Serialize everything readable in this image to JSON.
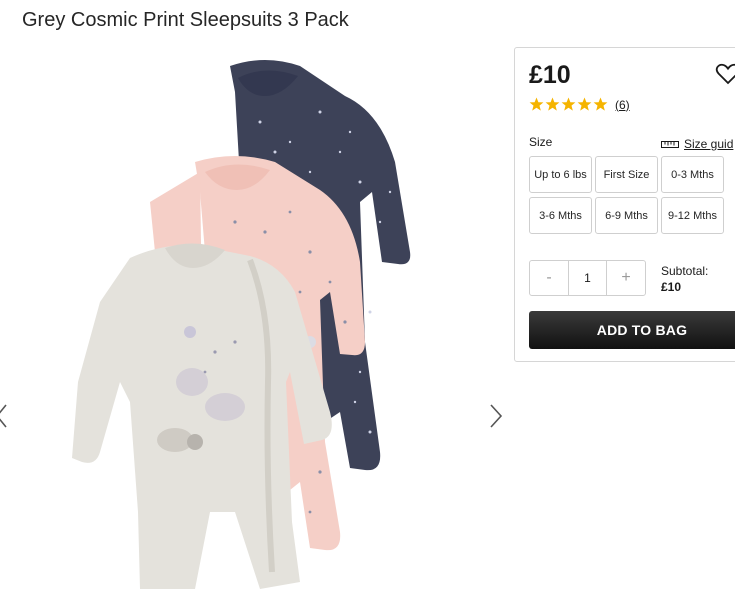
{
  "product": {
    "title": "Grey Cosmic Print Sleepsuits 3 Pack",
    "price": "£10",
    "rating": 5,
    "review_count": "(6)"
  },
  "size_selector": {
    "label": "Size",
    "guide_label": "Size guid",
    "options": [
      "Up to 6 lbs",
      "First Size",
      "0-3 Mths",
      "3-6 Mths",
      "6-9 Mths",
      "9-12 Mths"
    ]
  },
  "quantity": {
    "minus": "-",
    "value": "1",
    "plus": "+"
  },
  "subtotal": {
    "label": "Subtotal:",
    "value": "£10"
  },
  "actions": {
    "add_to_bag": "ADD TO BAG"
  },
  "icons": {
    "prev": "chevron-left-icon",
    "next": "chevron-right-icon",
    "wishlist": "heart-icon",
    "size_guide": "ruler-icon",
    "rating": "star-icon"
  },
  "colors": {
    "star": "#f5b400",
    "button": "#1a1a1a",
    "navy_suit": "#3d4258",
    "pink_suit": "#f5cfc7",
    "grey_suit": "#e4e2dc"
  }
}
